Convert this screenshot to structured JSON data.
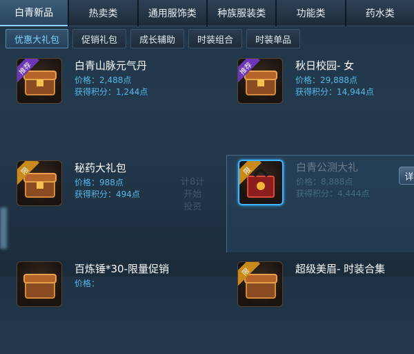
{
  "top_tabs": [
    {
      "label": "白青新品",
      "active": true
    },
    {
      "label": "热卖类"
    },
    {
      "label": "通用服饰类"
    },
    {
      "label": "种族服装类"
    },
    {
      "label": "功能类"
    },
    {
      "label": "药水类"
    }
  ],
  "sub_tabs": [
    {
      "label": "优惠大礼包",
      "active": true
    },
    {
      "label": "促销礼包"
    },
    {
      "label": "成长辅助"
    },
    {
      "label": "时装组合"
    },
    {
      "label": "时装单品"
    }
  ],
  "items": [
    {
      "name": "白青山脉元气丹",
      "price": "价格：2,488点",
      "points": "获得积分：1,244点",
      "badge": "推荐",
      "icon": "treasure-chest-icon"
    },
    {
      "name": "秋日校园- 女",
      "price": "价格：29,888点",
      "points": "获得积分：14,944点",
      "badge": "推荐",
      "icon": "treasure-chest-icon"
    },
    {
      "name": "秘药大礼包",
      "price": "价格：988点",
      "points": "获得积分：494点",
      "badge": "限",
      "icon": "treasure-chest-icon"
    },
    {
      "name": "白青公测大礼",
      "price": "价格：8,888点",
      "points": "获得积分：4,444点",
      "badge": "限",
      "icon": "red-gift-box-icon"
    },
    {
      "name": "百炼锤*30-限量促销",
      "price": "价格：",
      "points": "",
      "badge": "",
      "icon": "treasure-chest-icon"
    },
    {
      "name": "超级美眉- 时装合集",
      "price": "",
      "points": "",
      "badge": "限",
      "icon": "treasure-chest-icon"
    }
  ],
  "detail_button_label": "详",
  "watermark_text": [
    "计8计",
    "开始",
    "投资"
  ],
  "colors": {
    "accent": "#57b8e8",
    "active_subtab": "#7fd4ff",
    "badge_purple": "#6c36b8",
    "badge_gold": "#c98a1c"
  }
}
